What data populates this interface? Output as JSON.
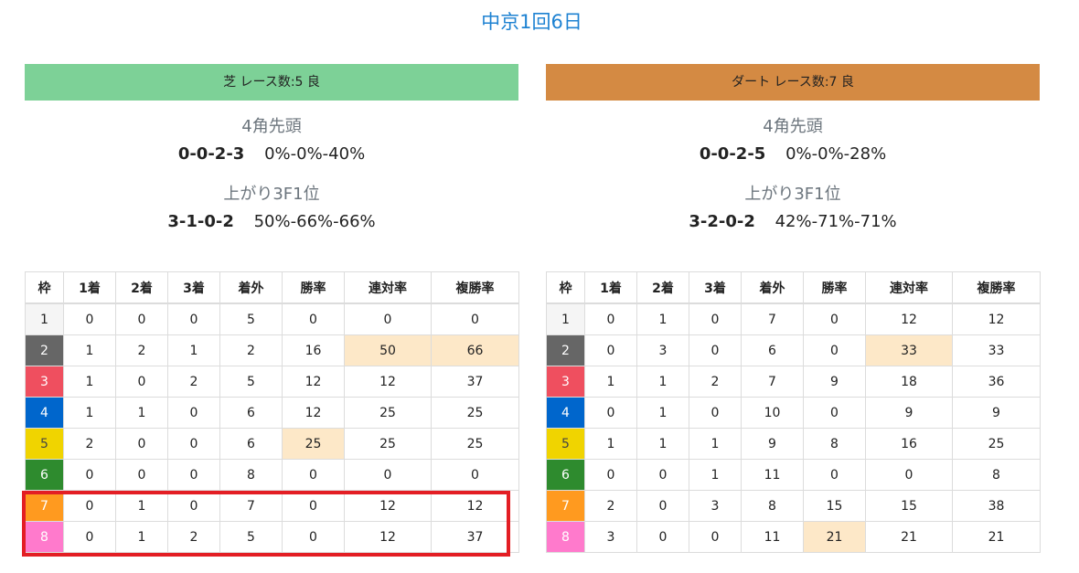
{
  "page": {
    "title": "中京1回6日"
  },
  "colors": {
    "turf_header": "#7dd197",
    "dirt_header": "#d48a43",
    "title": "#1e82d2",
    "highlight_cell": "#fde8c8",
    "callout_border": "#e31e24"
  },
  "waku_colors": [
    "#f5f5f5",
    "#666666",
    "#ef4f5f",
    "#0066cc",
    "#f0d400",
    "#2e8b2e",
    "#ff9a1f",
    "#ff7acc"
  ],
  "columns": [
    "枠",
    "1着",
    "2着",
    "3着",
    "着外",
    "勝率",
    "連対率",
    "複勝率"
  ],
  "turf": {
    "header": "芝 レース数:5 良",
    "stat1_label": "4角先頭",
    "stat1_record": "0-0-2-3",
    "stat1_pct": "0%-0%-40%",
    "stat2_label": "上がり3F1位",
    "stat2_record": "3-1-0-2",
    "stat2_pct": "50%-66%-66%",
    "rows": [
      {
        "waku": "1",
        "cells": [
          "0",
          "0",
          "0",
          "5",
          "0",
          "0",
          "0"
        ],
        "hl": []
      },
      {
        "waku": "2",
        "cells": [
          "1",
          "2",
          "1",
          "2",
          "16",
          "50",
          "66"
        ],
        "hl": [
          5,
          6
        ]
      },
      {
        "waku": "3",
        "cells": [
          "1",
          "0",
          "2",
          "5",
          "12",
          "12",
          "37"
        ],
        "hl": []
      },
      {
        "waku": "4",
        "cells": [
          "1",
          "1",
          "0",
          "6",
          "12",
          "25",
          "25"
        ],
        "hl": []
      },
      {
        "waku": "5",
        "cells": [
          "2",
          "0",
          "0",
          "6",
          "25",
          "25",
          "25"
        ],
        "hl": [
          4
        ]
      },
      {
        "waku": "6",
        "cells": [
          "0",
          "0",
          "0",
          "8",
          "0",
          "0",
          "0"
        ],
        "hl": []
      },
      {
        "waku": "7",
        "cells": [
          "0",
          "1",
          "0",
          "7",
          "0",
          "12",
          "12"
        ],
        "hl": []
      },
      {
        "waku": "8",
        "cells": [
          "0",
          "1",
          "2",
          "5",
          "0",
          "12",
          "37"
        ],
        "hl": []
      }
    ]
  },
  "dirt": {
    "header": "ダート レース数:7 良",
    "stat1_label": "4角先頭",
    "stat1_record": "0-0-2-5",
    "stat1_pct": "0%-0%-28%",
    "stat2_label": "上がり3F1位",
    "stat2_record": "3-2-0-2",
    "stat2_pct": "42%-71%-71%",
    "rows": [
      {
        "waku": "1",
        "cells": [
          "0",
          "1",
          "0",
          "7",
          "0",
          "12",
          "12"
        ],
        "hl": []
      },
      {
        "waku": "2",
        "cells": [
          "0",
          "3",
          "0",
          "6",
          "0",
          "33",
          "33"
        ],
        "hl": [
          5
        ]
      },
      {
        "waku": "3",
        "cells": [
          "1",
          "1",
          "2",
          "7",
          "9",
          "18",
          "36"
        ],
        "hl": []
      },
      {
        "waku": "4",
        "cells": [
          "0",
          "1",
          "0",
          "10",
          "0",
          "9",
          "9"
        ],
        "hl": []
      },
      {
        "waku": "5",
        "cells": [
          "1",
          "1",
          "1",
          "9",
          "8",
          "16",
          "25"
        ],
        "hl": []
      },
      {
        "waku": "6",
        "cells": [
          "0",
          "0",
          "1",
          "11",
          "0",
          "0",
          "8"
        ],
        "hl": []
      },
      {
        "waku": "7",
        "cells": [
          "2",
          "0",
          "3",
          "8",
          "15",
          "15",
          "38"
        ],
        "hl": []
      },
      {
        "waku": "8",
        "cells": [
          "3",
          "0",
          "0",
          "11",
          "21",
          "21",
          "21"
        ],
        "hl": [
          4
        ]
      }
    ]
  }
}
